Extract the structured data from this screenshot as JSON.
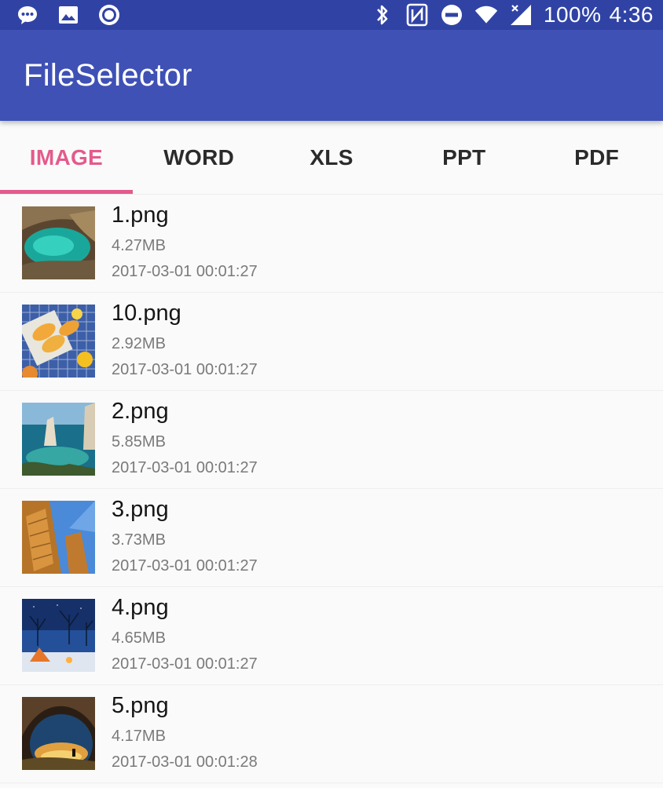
{
  "status_bar": {
    "left_icons": [
      "message-icon",
      "image-icon",
      "record-icon"
    ],
    "right_icons": [
      "bluetooth-icon",
      "nfc-icon",
      "do-not-disturb-icon",
      "wifi-icon",
      "signal-icon"
    ],
    "battery": "100%",
    "time": "4:36"
  },
  "app_bar": {
    "title": "FileSelector",
    "color": "#3f51b5"
  },
  "tabs": [
    {
      "label": "IMAGE",
      "active": true
    },
    {
      "label": "WORD",
      "active": false
    },
    {
      "label": "XLS",
      "active": false
    },
    {
      "label": "PPT",
      "active": false
    },
    {
      "label": "PDF",
      "active": false
    }
  ],
  "accent_color": "#e45a8c",
  "files": [
    {
      "name": "1.png",
      "size": "4.27MB",
      "date": "2017-03-01 00:01:27",
      "thumbnail": "cave-lagoon-thumbnail"
    },
    {
      "name": "10.png",
      "size": "2.92MB",
      "date": "2017-03-01 00:01:27",
      "thumbnail": "popsicles-thumbnail"
    },
    {
      "name": "2.png",
      "size": "5.85MB",
      "date": "2017-03-01 00:01:27",
      "thumbnail": "sea-cliffs-thumbnail"
    },
    {
      "name": "3.png",
      "size": "3.73MB",
      "date": "2017-03-01 00:01:27",
      "thumbnail": "temple-columns-thumbnail"
    },
    {
      "name": "4.png",
      "size": "4.65MB",
      "date": "2017-03-01 00:01:27",
      "thumbnail": "night-camping-thumbnail"
    },
    {
      "name": "5.png",
      "size": "4.17MB",
      "date": "2017-03-01 00:01:28",
      "thumbnail": "cave-sunset-thumbnail"
    }
  ]
}
